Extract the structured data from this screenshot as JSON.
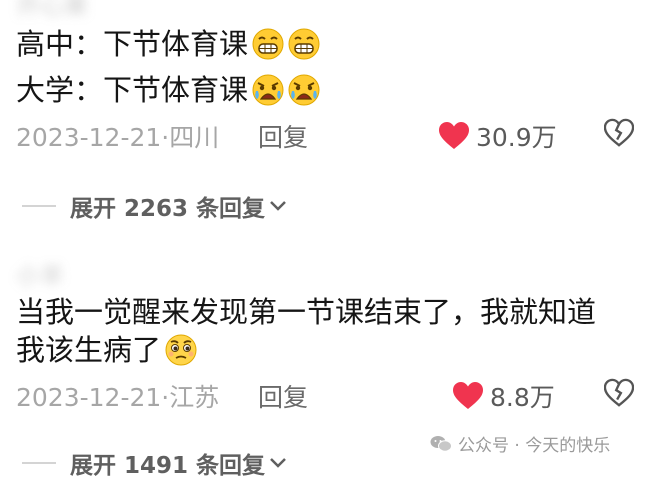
{
  "comments": [
    {
      "username": "开心果",
      "lines": [
        {
          "text": "高中：下节体育课",
          "emojis": [
            "grin-emoji",
            "grin-emoji"
          ]
        },
        {
          "text": "大学：下节体育课",
          "emojis": [
            "crying-emoji",
            "crying-emoji"
          ]
        }
      ],
      "date": "2023-12-21·",
      "location": "四川",
      "reply_label": "回复",
      "likes": "30.9万",
      "expand_label": "展开 2263 条回复"
    },
    {
      "username": "小羊",
      "lines": [
        {
          "text": "当我一觉醒来发现第一节课结束了，我就知道",
          "emojis": []
        },
        {
          "text": "我该生病了",
          "emojis": [
            "pleading-emoji"
          ]
        }
      ],
      "date": "2023-12-21·",
      "location": "江苏",
      "reply_label": "回复",
      "likes": "8.8万",
      "expand_label": "展开 1491 条回复"
    }
  ],
  "watermark": "公众号 · 今天的快乐",
  "colors": {
    "heart": "#f0344f",
    "text": "#151515",
    "meta": "#a6a6a6"
  }
}
